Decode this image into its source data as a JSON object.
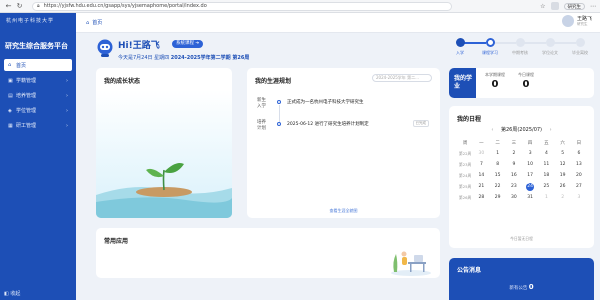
{
  "browser": {
    "url": "https://yjsfw.hdu.edu.cn/gsapp/sys/yjsemaphome/portal/index.do",
    "profile_label": "研究生"
  },
  "sidebar": {
    "logo_text": "杭州电子科技大学",
    "title": "研究生综合服务平台",
    "items": [
      {
        "label": "首页",
        "icon": "home-icon",
        "active": true
      },
      {
        "label": "学籍管理",
        "icon": "student-icon"
      },
      {
        "label": "培养管理",
        "icon": "book-icon"
      },
      {
        "label": "学位管理",
        "icon": "degree-icon"
      },
      {
        "label": "研工管理",
        "icon": "work-icon"
      }
    ],
    "collapse_label": "收起"
  },
  "tabs": {
    "home_label": "首页"
  },
  "user": {
    "name": "王路飞",
    "sub": "研究生"
  },
  "greeting": {
    "hello": "Hi!王路飞",
    "guide_label": "系统课程 ➔",
    "date_prefix": "今天是7月24日 星期四 ",
    "term": "2024-2025学年第二学期 第26周"
  },
  "steps": [
    {
      "label": "入学",
      "state": "done"
    },
    {
      "label": "课程学习",
      "state": "current"
    },
    {
      "label": "中期考核",
      "state": "todo"
    },
    {
      "label": "学位论文",
      "state": "todo"
    },
    {
      "label": "毕业离校",
      "state": "todo"
    }
  ],
  "growth": {
    "title": "我的成长状态"
  },
  "plan": {
    "title": "我的生涯规划",
    "select_placeholder": "2024-2025学年 第二...",
    "timeline": [
      {
        "label": "新生入学",
        "text": "正式成为一名杭州电子科技大学研究生",
        "tag": ""
      },
      {
        "label": "培养计划",
        "text": "2025-06-12 进行了研究生培养计划制定",
        "tag": "已完成"
      }
    ],
    "more_label": "查看生涯全貌图"
  },
  "apps": {
    "title": "常用应用"
  },
  "my_terms": {
    "badge": "我的学业",
    "stats": [
      {
        "label": "本学期课程",
        "value": "0"
      },
      {
        "label": "今日课程",
        "value": "0"
      }
    ]
  },
  "calendar": {
    "title": "我的日程",
    "month_label": "第26周(2025/07)",
    "day_headers": [
      "周",
      "一",
      "二",
      "三",
      "四",
      "五",
      "六",
      "日"
    ],
    "weeks": [
      [
        "第22周",
        "30",
        "1",
        "2",
        "3",
        "4",
        "5",
        "6"
      ],
      [
        "第23周",
        "7",
        "8",
        "9",
        "10",
        "11",
        "12",
        "13"
      ],
      [
        "第24周",
        "14",
        "15",
        "16",
        "17",
        "18",
        "19",
        "20"
      ],
      [
        "第25周",
        "21",
        "22",
        "23",
        "24",
        "25",
        "26",
        "27"
      ],
      [
        "第26周",
        "28",
        "29",
        "30",
        "31",
        "1",
        "2",
        "3"
      ]
    ],
    "today": "24",
    "footer": "今日暂无日程"
  },
  "notice": {
    "title": "公告消息",
    "count_prefix": "新有公告 ",
    "count": "0"
  },
  "colors": {
    "primary": "#1d4fb6",
    "accent": "#2d62d6",
    "background": "#eef2f8"
  }
}
